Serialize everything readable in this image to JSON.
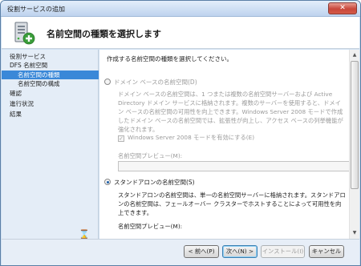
{
  "window": {
    "title": "役割サービスの追加",
    "close_glyph": "✕"
  },
  "header": {
    "title": "名前空間の種類を選択します",
    "icon": "server-add-icon"
  },
  "sidebar": {
    "items": [
      {
        "label": "役割サービス",
        "level": 0,
        "active": false
      },
      {
        "label": "DFS 名前空間",
        "level": 0,
        "active": false
      },
      {
        "label": "名前空間の種類",
        "level": 1,
        "active": true
      },
      {
        "label": "名前空間の構成",
        "level": 1,
        "active": false
      },
      {
        "label": "確認",
        "level": 0,
        "active": false
      },
      {
        "label": "進行状況",
        "level": 0,
        "active": false
      },
      {
        "label": "結果",
        "level": 0,
        "active": false
      }
    ],
    "busy_icon": "⌛"
  },
  "content": {
    "intro": "作成する名前空間の種類を選択してください。",
    "domain_option": {
      "label": "ドメイン ベースの名前空間(D)",
      "checked": false,
      "enabled": false,
      "description": "ドメイン ベースの名前空間は、1 つまたは複数の名前空間サーバーおよび Active Directory ドメイン サービスに格納されます。複数のサーバーを使用すると、ドメイン ベースの名前空間の可用性を向上できます。Windows Server 2008 モードで作成したドメイン ベースの名前空間では、拡張性が向上し、アクセス ベースの列挙機能が強化されます。",
      "mode_checkbox_label": "Windows Server 2008 モードを有効にする(E)",
      "mode_checkbox_checked": true,
      "check_glyph": "✓",
      "preview_label": "名前空間プレビュー(M):",
      "preview_value": ""
    },
    "standalone_option": {
      "label": "スタンドアロンの名前空間(S)",
      "checked": true,
      "enabled": true,
      "description": "スタンドアロンの名前空間は、単一の名前空間サーバーに格納されます。スタンドアロンの名前空間は、フェールオーバー クラスターでホストすることによって可用性を向上できます。",
      "preview_label": "名前空間プレビュー(M):"
    }
  },
  "scrollbar": {
    "up_glyph": "▲",
    "down_glyph": "▼"
  },
  "footer": {
    "back": "< 前へ(P)",
    "next": "次へ(N) >",
    "install": "インストール(I)",
    "cancel": "キャンセル"
  },
  "colors": {
    "selection": "#3a88d8",
    "sidebar_bg": "#e4edf7",
    "close_button": "#c8473a"
  }
}
